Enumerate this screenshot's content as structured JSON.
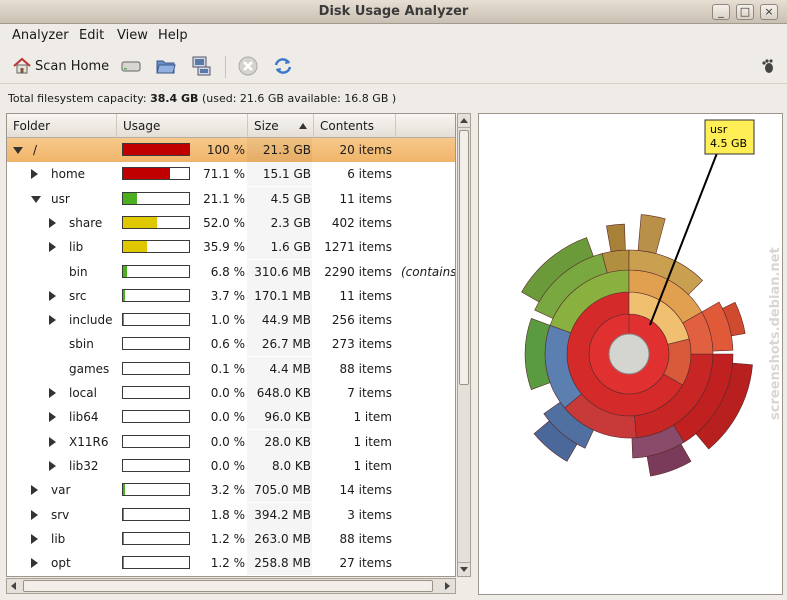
{
  "window": {
    "title": "Disk Usage Analyzer",
    "buttons": [
      "_",
      "□",
      "×"
    ]
  },
  "menubar": {
    "items": [
      "Analyzer",
      "Edit",
      "View",
      "Help"
    ]
  },
  "toolbar": {
    "scan_home_label": "Scan Home",
    "icons": [
      "home-icon",
      "drive-icon",
      "folder-open-icon",
      "network-icon",
      "stop-icon",
      "refresh-icon",
      "gnome-foot-icon"
    ]
  },
  "capacity": {
    "prefix": "Total filesystem capacity:",
    "total": "38.4 GB",
    "detail": "(used: 21.6 GB available: 16.8 GB )"
  },
  "columns": {
    "folder": "Folder",
    "usage": "Usage",
    "size": "Size",
    "contents": "Contents"
  },
  "rows": [
    {
      "name": "/",
      "pct": "100 %",
      "size": "21.3 GB",
      "items": "20 items",
      "fill": 1.0,
      "color": "#c00000",
      "level": 0,
      "exp": "open",
      "sel": true
    },
    {
      "name": "home",
      "pct": "71.1 %",
      "size": "15.1 GB",
      "items": "6 items",
      "fill": 0.711,
      "color": "#c00000",
      "level": 1,
      "exp": "closed"
    },
    {
      "name": "usr",
      "pct": "21.1 %",
      "size": "4.5 GB",
      "items": "11 items",
      "fill": 0.211,
      "color": "#4caf1f",
      "level": 1,
      "exp": "open"
    },
    {
      "name": "share",
      "pct": "52.0 %",
      "size": "2.3 GB",
      "items": "402 items",
      "fill": 0.52,
      "color": "#e0c800",
      "level": 2,
      "exp": "closed"
    },
    {
      "name": "lib",
      "pct": "35.9 %",
      "size": "1.6 GB",
      "items": "1271 items",
      "fill": 0.359,
      "color": "#e0c800",
      "level": 2,
      "exp": "closed"
    },
    {
      "name": "bin",
      "pct": "6.8 %",
      "size": "310.6 MB",
      "items": "2290 items",
      "fill": 0.068,
      "color": "#4caf1f",
      "level": 2,
      "exp": "none",
      "extra": "(contains"
    },
    {
      "name": "src",
      "pct": "3.7 %",
      "size": "170.1 MB",
      "items": "11 items",
      "fill": 0.037,
      "color": "#4caf1f",
      "level": 2,
      "exp": "closed"
    },
    {
      "name": "include",
      "pct": "1.0 %",
      "size": "44.9 MB",
      "items": "256 items",
      "fill": 0.01,
      "color": "#4caf1f",
      "level": 2,
      "exp": "closed"
    },
    {
      "name": "sbin",
      "pct": "0.6 %",
      "size": "26.7 MB",
      "items": "273 items",
      "fill": 0.0,
      "color": "#4caf1f",
      "level": 2,
      "exp": "none"
    },
    {
      "name": "games",
      "pct": "0.1 %",
      "size": "4.4 MB",
      "items": "88 items",
      "fill": 0.0,
      "color": "#4caf1f",
      "level": 2,
      "exp": "none"
    },
    {
      "name": "local",
      "pct": "0.0 %",
      "size": "648.0 KB",
      "items": "7 items",
      "fill": 0.0,
      "color": "#4caf1f",
      "level": 2,
      "exp": "closed"
    },
    {
      "name": "lib64",
      "pct": "0.0 %",
      "size": "96.0 KB",
      "items": "1 item",
      "fill": 0.0,
      "color": "#4caf1f",
      "level": 2,
      "exp": "closed"
    },
    {
      "name": "X11R6",
      "pct": "0.0 %",
      "size": "28.0 KB",
      "items": "1 item",
      "fill": 0.0,
      "color": "#4caf1f",
      "level": 2,
      "exp": "closed"
    },
    {
      "name": "lib32",
      "pct": "0.0 %",
      "size": "8.0 KB",
      "items": "1 item",
      "fill": 0.0,
      "color": "#4caf1f",
      "level": 2,
      "exp": "closed"
    },
    {
      "name": "var",
      "pct": "3.2 %",
      "size": "705.0 MB",
      "items": "14 items",
      "fill": 0.032,
      "color": "#4caf1f",
      "level": 1,
      "exp": "closed"
    },
    {
      "name": "srv",
      "pct": "1.8 %",
      "size": "394.2 MB",
      "items": "3 items",
      "fill": 0.018,
      "color": "#4caf1f",
      "level": 1,
      "exp": "closed"
    },
    {
      "name": "lib",
      "pct": "1.2 %",
      "size": "263.0 MB",
      "items": "88 items",
      "fill": 0.012,
      "color": "#4caf1f",
      "level": 1,
      "exp": "closed"
    },
    {
      "name": "opt",
      "pct": "1.2 %",
      "size": "258.8 MB",
      "items": "27 items",
      "fill": 0.012,
      "color": "#4caf1f",
      "level": 1,
      "exp": "closed"
    }
  ],
  "chart": {
    "tooltip_name": "usr",
    "tooltip_size": "4.5 GB"
  },
  "watermark": "screenshots.debian.net"
}
